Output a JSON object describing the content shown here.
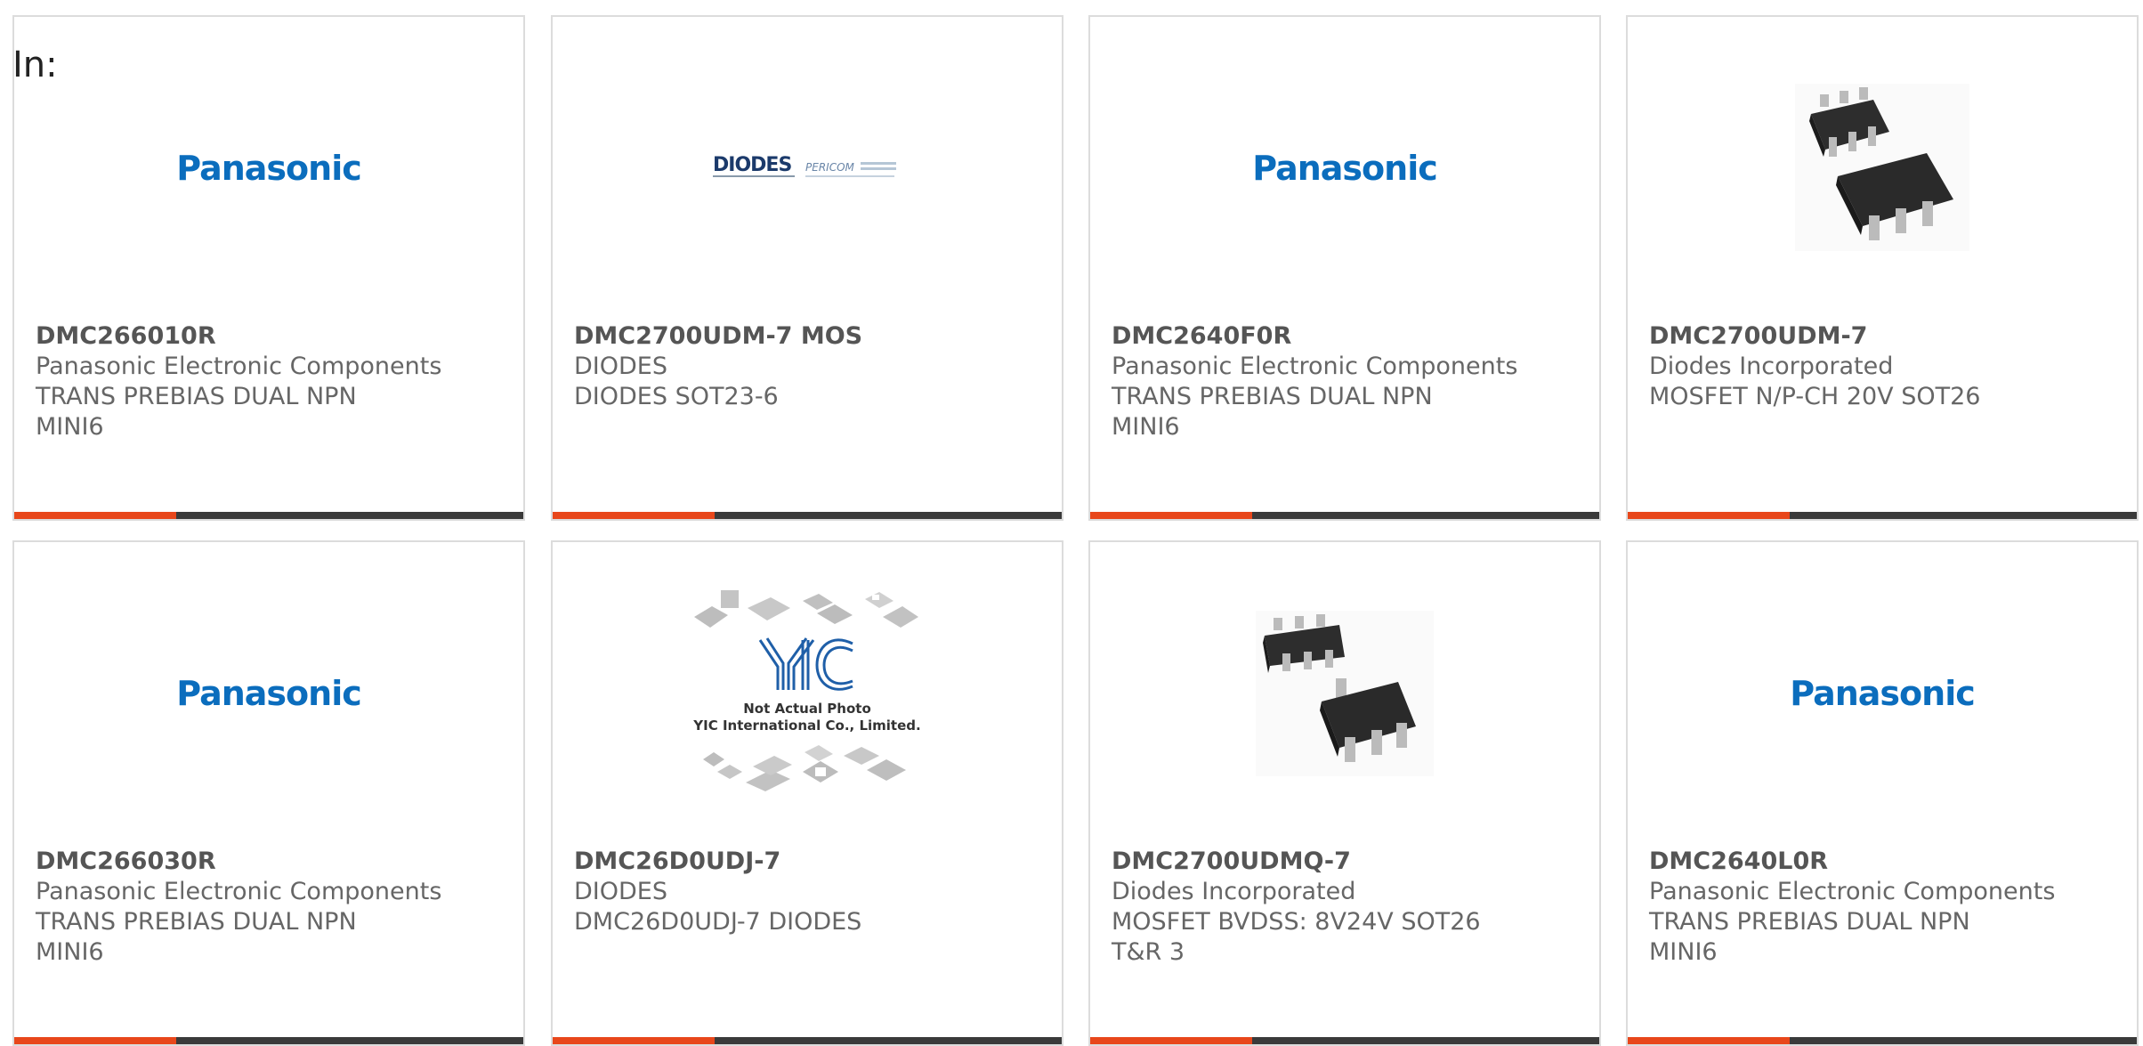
{
  "header": {
    "label": "In:"
  },
  "colors": {
    "accent": "#e8471b",
    "bar": "#3a3a3a",
    "panasonic_blue": "#0b6dbd",
    "diodes_navy": "#1b3a6b"
  },
  "cards": [
    {
      "image": "panasonic-logo",
      "image_text": "Panasonic",
      "part": "DMC266010R",
      "mfr": "Panasonic Electronic Components",
      "desc1": "TRANS PREBIAS DUAL NPN",
      "desc2": "MINI6"
    },
    {
      "image": "diodes-pericom-logo",
      "image_text": "DIODES",
      "image_text2": "PERICOM",
      "part": "DMC2700UDM-7 MOS",
      "mfr": "DIODES",
      "desc1": "DIODES SOT23-6",
      "desc2": ""
    },
    {
      "image": "panasonic-logo",
      "image_text": "Panasonic",
      "part": "DMC2640F0R",
      "mfr": "Panasonic Electronic Components",
      "desc1": "TRANS PREBIAS DUAL NPN",
      "desc2": "MINI6"
    },
    {
      "image": "sot26-chip-photo",
      "part": "DMC2700UDM-7",
      "mfr": "Diodes Incorporated",
      "desc1": "MOSFET N/P-CH 20V SOT26",
      "desc2": ""
    },
    {
      "image": "panasonic-logo",
      "image_text": "Panasonic",
      "part": "DMC266030R",
      "mfr": "Panasonic Electronic Components",
      "desc1": "TRANS PREBIAS DUAL NPN",
      "desc2": "MINI6"
    },
    {
      "image": "yic-placeholder",
      "image_text": "Not Actual Photo",
      "image_text2": "YIC International Co., Limited.",
      "part": "DMC26D0UDJ-7",
      "mfr": "DIODES",
      "desc1": "DMC26D0UDJ-7 DIODES",
      "desc2": ""
    },
    {
      "image": "sot26-chip-photo",
      "part": "DMC2700UDMQ-7",
      "mfr": "Diodes Incorporated",
      "desc1": "MOSFET BVDSS: 8V24V SOT26",
      "desc2": "T&R 3"
    },
    {
      "image": "panasonic-logo",
      "image_text": "Panasonic",
      "part": "DMC2640L0R",
      "mfr": "Panasonic Electronic Components",
      "desc1": "TRANS PREBIAS DUAL NPN",
      "desc2": "MINI6"
    }
  ]
}
